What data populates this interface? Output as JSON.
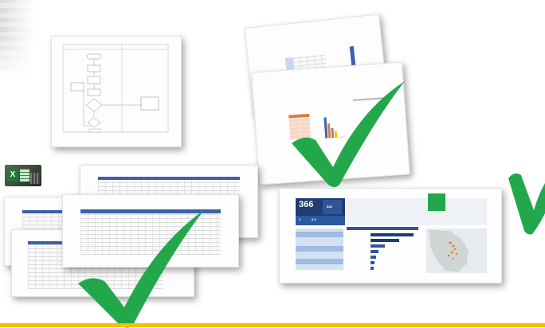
{
  "colors": {
    "check_green": "#22a84a",
    "accent_yellow": "#f2c200",
    "sheet_header_blue": "#3a62a8",
    "dashboard_navy": "#1f3d73"
  },
  "dashboard": {
    "kpi_main": "366",
    "kpi_secondary": "838",
    "kpi_small_a": "2",
    "kpi_small_b": "0.0"
  },
  "icons": [
    "excel-icon",
    "checkmark-icon"
  ]
}
